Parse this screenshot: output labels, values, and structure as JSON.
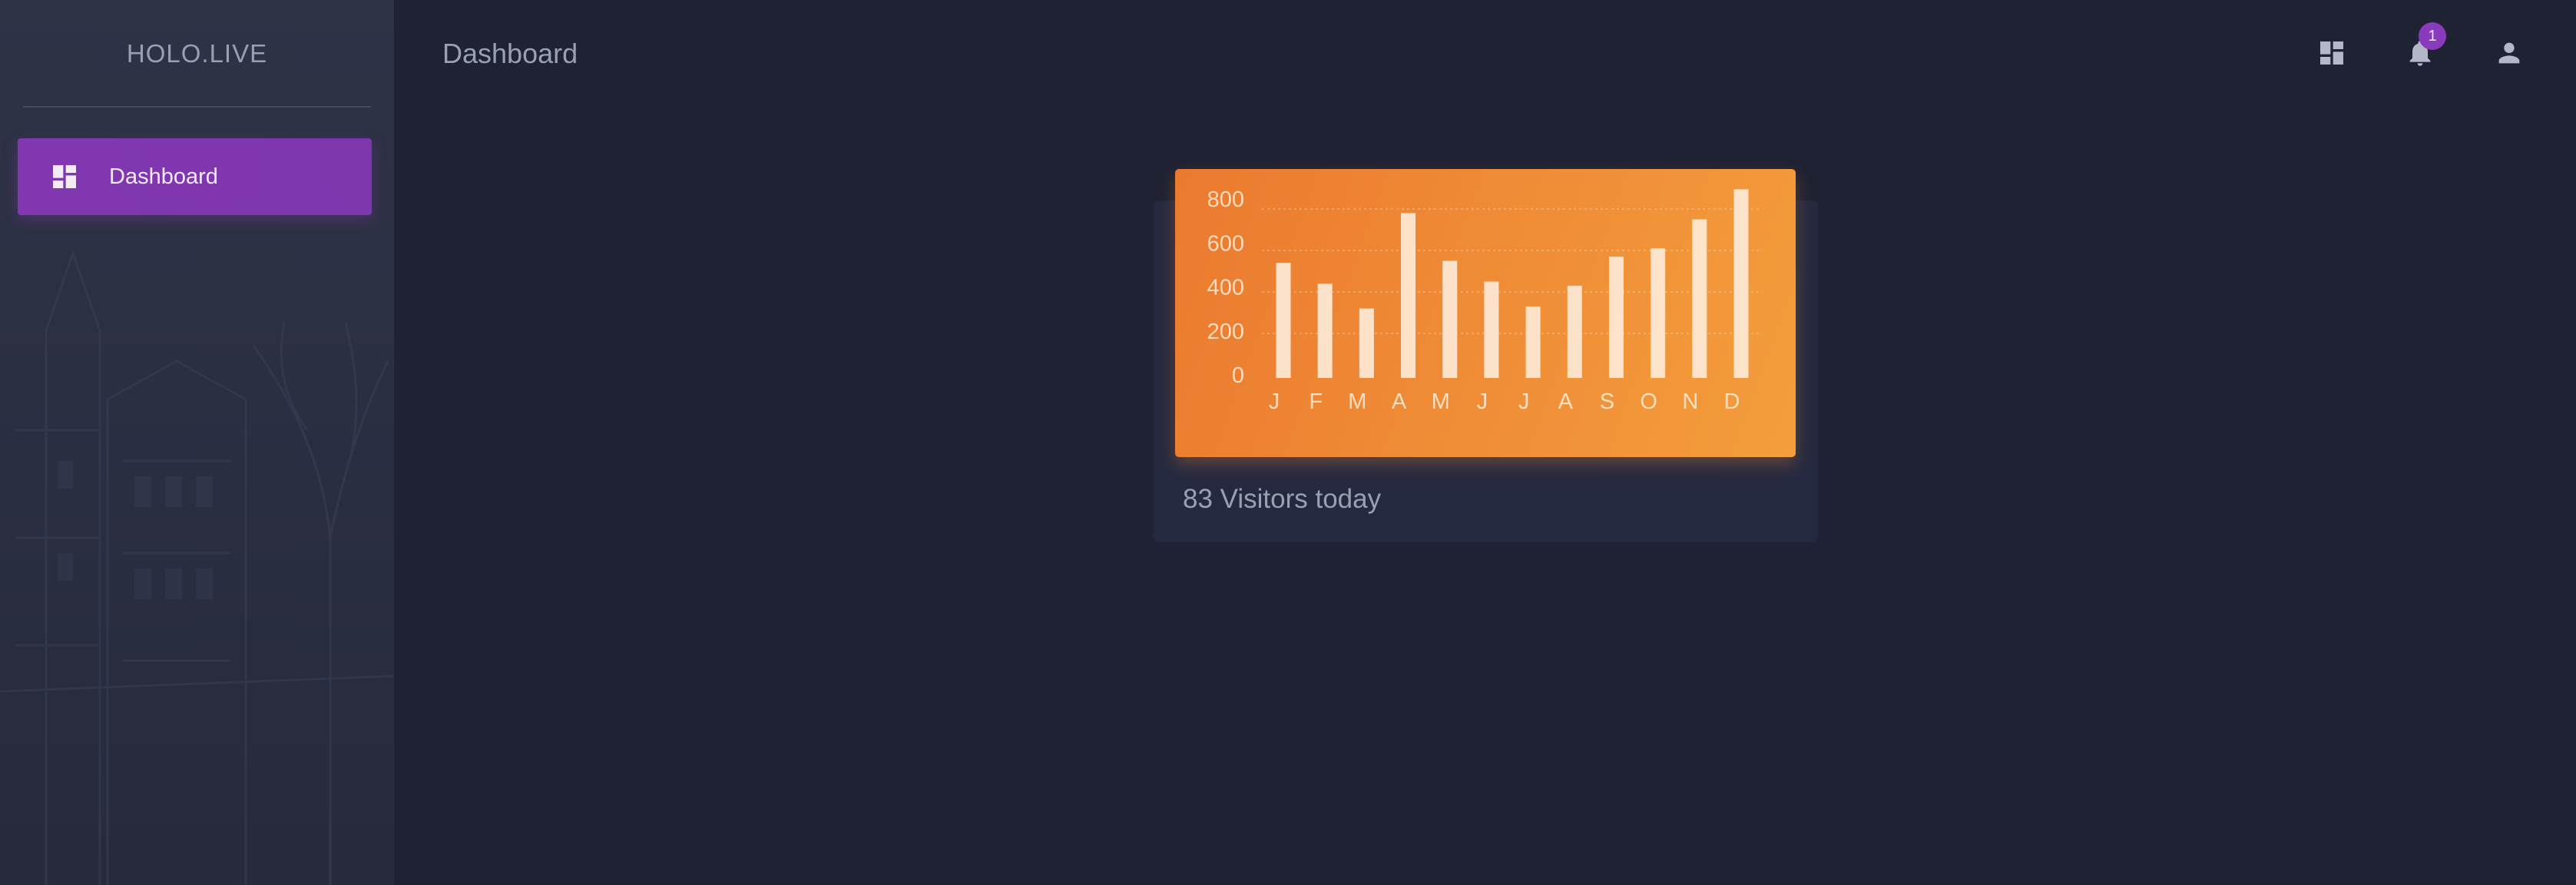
{
  "app": {
    "brand": "HOLO.LIVE"
  },
  "sidebar": {
    "items": [
      {
        "label": "Dashboard",
        "icon": "dashboard-icon",
        "active": true
      }
    ]
  },
  "header": {
    "title": "Dashboard",
    "icons": [
      "dashboard-icon",
      "bell-icon",
      "person-icon"
    ],
    "notification_count": "1"
  },
  "card": {
    "caption": "83 Visitors today"
  },
  "colors": {
    "accent": "#8037b0",
    "chart_panel": "#f08e37",
    "bars": "#fde7d2"
  },
  "chart_data": {
    "type": "bar",
    "categories": [
      "J",
      "F",
      "M",
      "A",
      "M",
      "J",
      "J",
      "A",
      "S",
      "O",
      "N",
      "D"
    ],
    "values": [
      540,
      440,
      320,
      780,
      550,
      450,
      330,
      430,
      570,
      610,
      750,
      895
    ],
    "yticks": [
      0,
      200,
      400,
      600,
      800
    ],
    "ylim": [
      0,
      900
    ],
    "grid": true,
    "title": "",
    "xlabel": "",
    "ylabel": ""
  }
}
